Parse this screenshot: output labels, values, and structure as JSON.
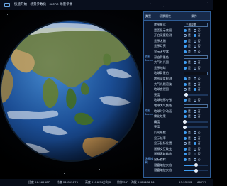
{
  "window": {
    "title": "快速开始 - 场景参数化 - scene 场景参数"
  },
  "panel": {
    "header": {
      "type": "类型",
      "param": "场景属性",
      "op": "操作"
    },
    "categories": [
      {
        "label": "地图Scene"
      },
      {
        "label": "地图Scene"
      },
      {
        "label": "场景效果"
      }
    ],
    "rows": [
      {
        "label": "底图模式",
        "control": "select",
        "value": "三维视图"
      },
      {
        "label": "是否显示底图",
        "control": "radio",
        "on": 0
      },
      {
        "label": "开启深度检测",
        "control": "radio",
        "on": 1
      },
      {
        "label": "显示太阳",
        "control": "radio",
        "on": 0
      },
      {
        "label": "显示月亮",
        "control": "radio",
        "on": 0
      },
      {
        "label": "显示天空盒",
        "control": "radio",
        "on": 0
      },
      {
        "label": "深空背景色",
        "control": "swatch",
        "color": "#0b0f19"
      },
      {
        "label": "大气外光圈",
        "control": "radio",
        "on": 0
      },
      {
        "label": "显示地球",
        "control": "radio",
        "on": 0
      },
      {
        "label": "地球背景色",
        "control": "swatch",
        "color": "#0b0f19"
      },
      {
        "label": "地形深度检测",
        "control": "radio",
        "on": 0
      },
      {
        "label": "大气光照渲染",
        "control": "radio",
        "on": 0
      },
      {
        "label": "地球夜视图",
        "control": "radio",
        "on": 1
      },
      {
        "label": "亮度",
        "control": "slider",
        "fraction": 0.1
      },
      {
        "label": "地球地形夸张",
        "control": "radio",
        "on": 0
      },
      {
        "label": "地球大气颜色",
        "control": "swatch",
        "color": "#0b0f19"
      },
      {
        "label": "地球时钟动画",
        "control": "radio",
        "on": 0
      },
      {
        "label": "雾化效果",
        "control": "radio",
        "on": 0
      },
      {
        "label": "精度",
        "control": "slider",
        "fraction": 0.05
      },
      {
        "label": "亮度",
        "control": "slider",
        "fraction": 0.05
      },
      {
        "label": "反光系数",
        "control": "radio",
        "on": 0
      },
      {
        "label": "显示帧率",
        "control": "radio",
        "on": 0
      },
      {
        "label": "显示鼠标位置",
        "control": "radio",
        "on": 1
      },
      {
        "label": "鼠标交互改变",
        "control": "radio",
        "on": 0
      },
      {
        "label": "鼠标滚轮缩放",
        "control": "radio",
        "on": 0
      },
      {
        "label": "鼠标旋转",
        "control": "radio",
        "on": 0
      },
      {
        "label": "键盘缩放大倍",
        "control": "slider",
        "fraction": 0.5
      },
      {
        "label": "键盘缩放大倍",
        "control": "slider",
        "fraction": 0.5
      }
    ],
    "radio_labels": [
      "是",
      "否"
    ]
  },
  "status": {
    "lon": "经度 26.962687",
    "lat": "纬度 21.855879",
    "alt": "高度 2126.34",
    "heading": "方向 2",
    "tilt": "俯仰 34°",
    "height": "海拔 2384486 16",
    "fps": "53.33 MS",
    "fps2": "60 FPS"
  },
  "colors": {
    "panel_border": "#2f5d96",
    "accent": "#3e9cf0",
    "ocean": "#1a4f9c",
    "land": "#4f7a3a"
  }
}
